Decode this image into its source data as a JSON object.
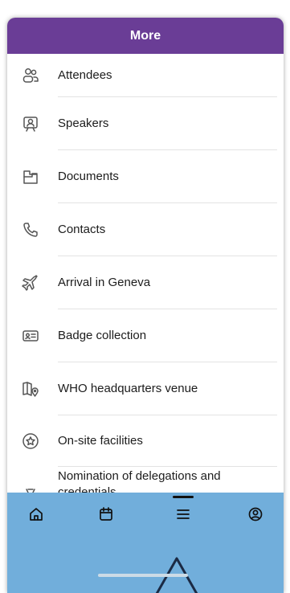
{
  "header": {
    "title": "More"
  },
  "menu": [
    {
      "label": "Attendees",
      "icon": "attendees-icon"
    },
    {
      "label": "Speakers",
      "icon": "speakers-icon"
    },
    {
      "label": "Documents",
      "icon": "documents-icon"
    },
    {
      "label": "Contacts",
      "icon": "phone-icon"
    },
    {
      "label": "Arrival in Geneva",
      "icon": "plane-icon"
    },
    {
      "label": "Badge collection",
      "icon": "badge-icon"
    },
    {
      "label": "WHO headquarters venue",
      "icon": "map-pin-icon"
    },
    {
      "label": "On-site facilities",
      "icon": "star-circle-icon"
    },
    {
      "label": "Nomination of delegations and credentials",
      "icon": "medal-icon"
    }
  ],
  "tabs": [
    {
      "icon": "home-icon"
    },
    {
      "icon": "calendar-icon"
    },
    {
      "icon": "menu-icon",
      "active": true
    },
    {
      "icon": "profile-icon"
    }
  ],
  "colors": {
    "header": "#6a3d96",
    "tabbar": "#71aedb"
  }
}
